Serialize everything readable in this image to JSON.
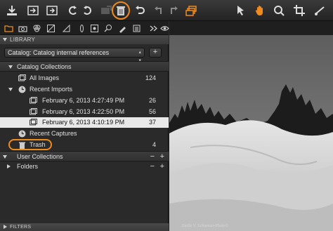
{
  "toolbar": {
    "icons": [
      "import-icon",
      "export-icon",
      "process-icon",
      "rotate-left-icon",
      "rotate-right-icon",
      "disabled-move-icon",
      "trash-icon",
      "undo-icon",
      "reset-left-icon",
      "redo-icon",
      "stack-icon",
      "select-cursor-icon",
      "pan-hand-icon",
      "zoom-icon",
      "crop-icon",
      "straighten-icon"
    ]
  },
  "tabs": [
    "folder-icon",
    "camera-icon",
    "color-icon",
    "exposure-icon",
    "details-icon",
    "lens-icon",
    "local-adjust-icon",
    "metadata-icon",
    "output-icon",
    "batch-icon",
    "more-icon",
    "eye-icon"
  ],
  "library": {
    "header": "LIBRARY",
    "catalog_select": "Catalog: Catalog internal references",
    "add_label": "+",
    "catalog_collections": "Catalog Collections",
    "all_images": {
      "label": "All Images",
      "count": "124"
    },
    "recent_imports": "Recent Imports",
    "imports": [
      {
        "label": "February 6, 2013 4:27:49 PM",
        "count": "26"
      },
      {
        "label": "February 6, 2013 4:22:50 PM",
        "count": "56"
      },
      {
        "label": "February 6, 2013 4:10:19 PM",
        "count": "37"
      }
    ],
    "recent_captures": "Recent Captures",
    "trash": {
      "label": "Trash",
      "count": "4"
    },
    "user_collections": "User Collections",
    "folders": "Folders",
    "minus_label": "−",
    "plus_label": "+"
  },
  "filters": {
    "header": "FILTERS"
  },
  "viewer": {
    "caption": "Emile V. Schurmer-Photo©"
  },
  "colors": {
    "highlight": "#f08a1c",
    "selected_row": "#e8e8e8"
  }
}
